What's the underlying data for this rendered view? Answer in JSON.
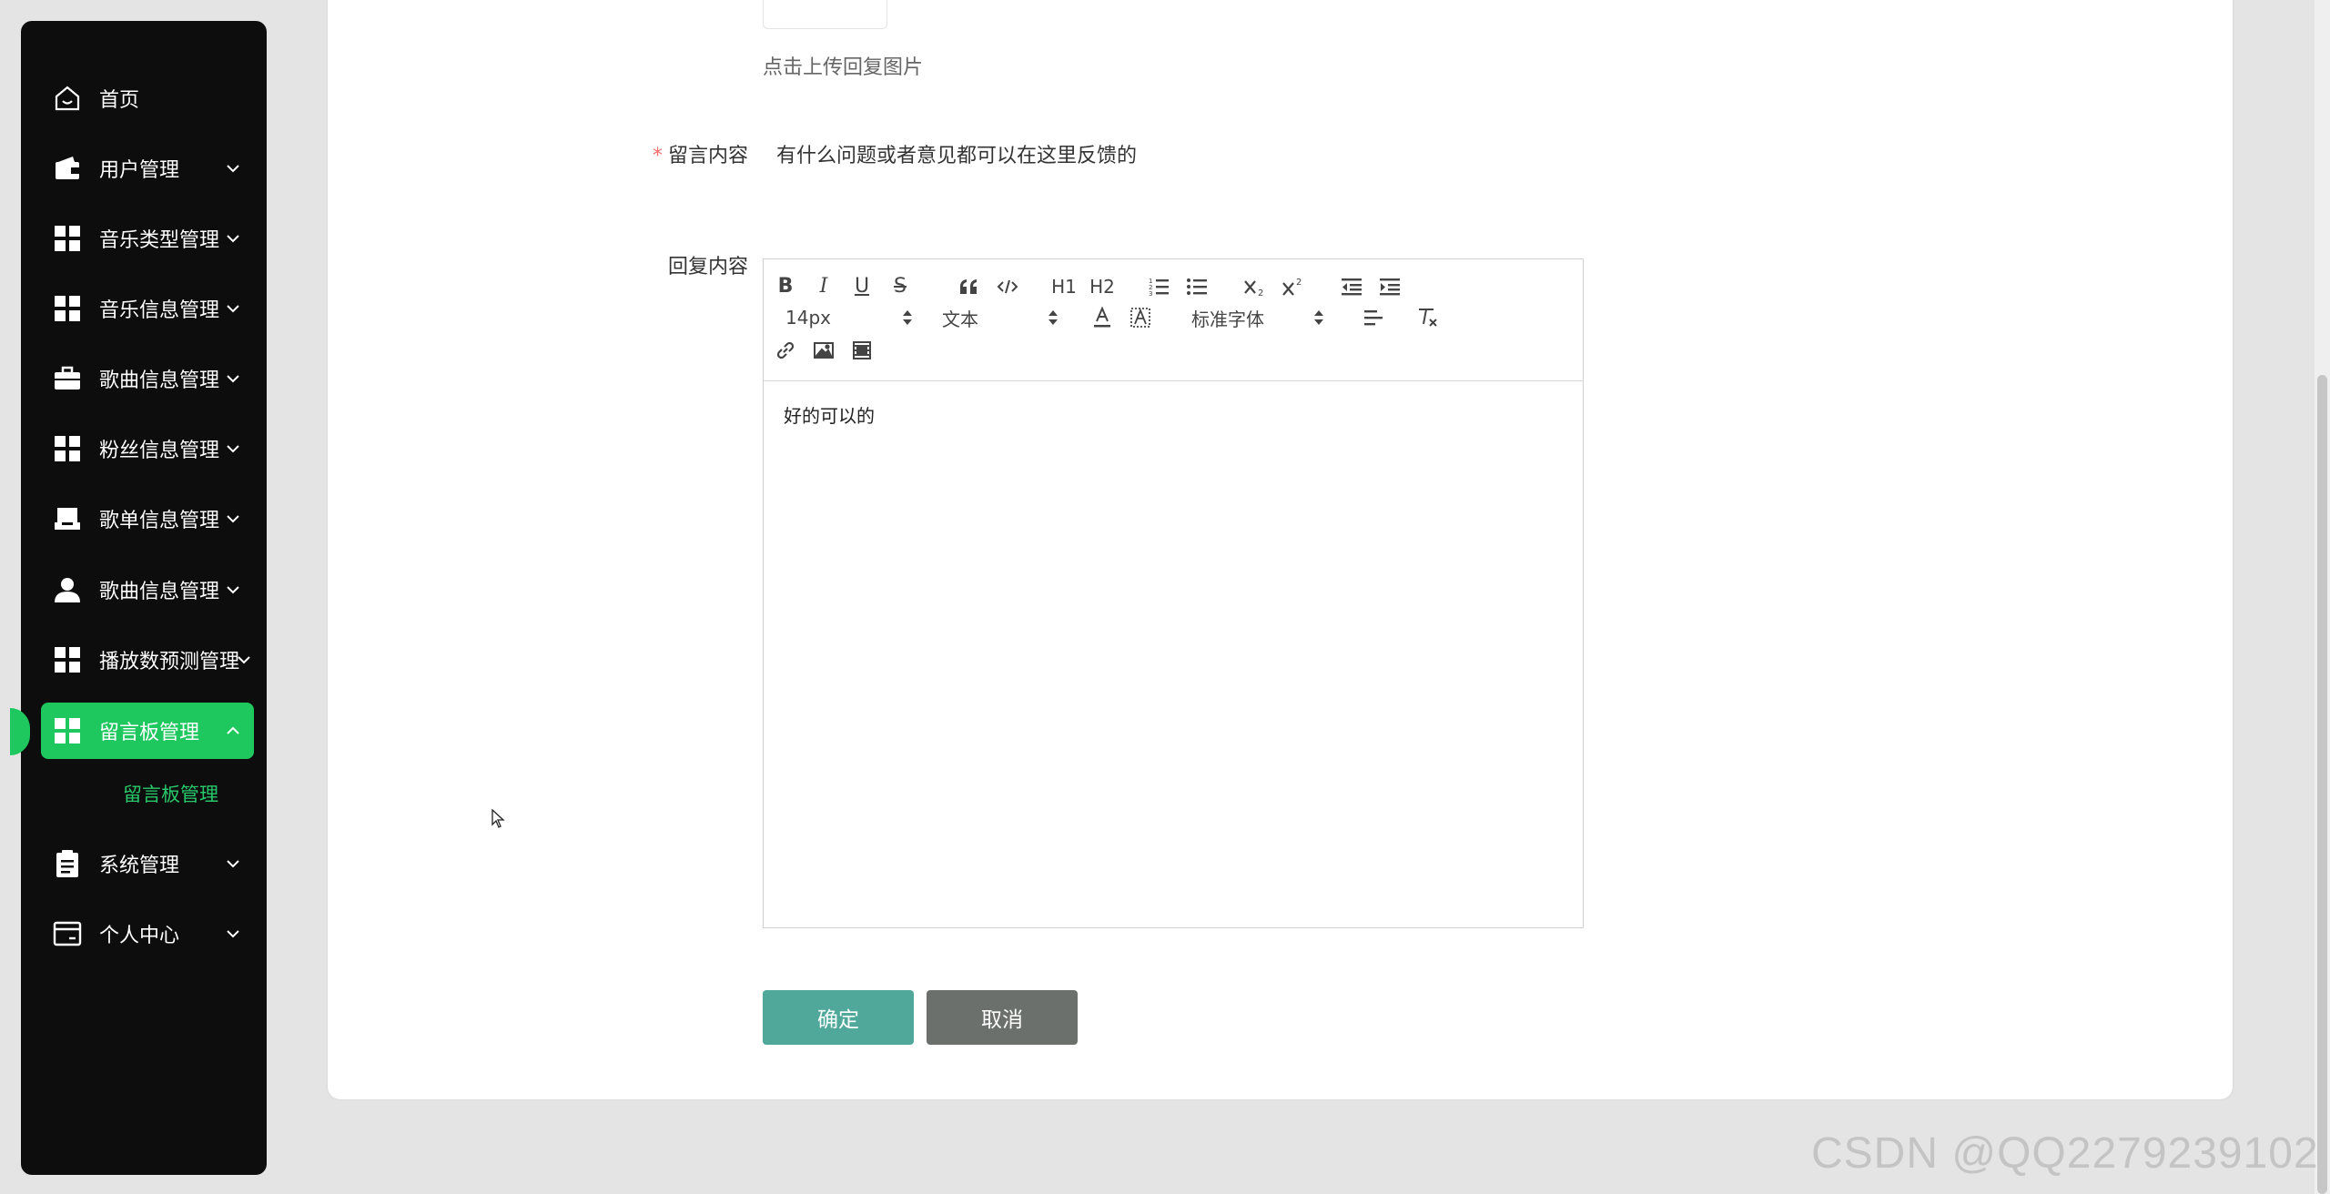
{
  "sidebar": {
    "items": [
      {
        "label": "首页",
        "icon": "home-icon"
      },
      {
        "label": "用户管理",
        "icon": "wallet-icon"
      },
      {
        "label": "音乐类型管理",
        "icon": "grid-icon"
      },
      {
        "label": "音乐信息管理",
        "icon": "grid-icon"
      },
      {
        "label": "歌曲信息管理",
        "icon": "briefcase-icon"
      },
      {
        "label": "粉丝信息管理",
        "icon": "grid-icon"
      },
      {
        "label": "歌单信息管理",
        "icon": "inbox-icon"
      },
      {
        "label": "歌曲信息管理",
        "icon": "user-icon"
      },
      {
        "label": "播放数预测管理",
        "icon": "grid-icon"
      },
      {
        "label": "留言板管理",
        "icon": "grid-icon",
        "active": true
      },
      {
        "label": "系统管理",
        "icon": "clipboard-icon"
      },
      {
        "label": "个人中心",
        "icon": "card-icon"
      }
    ],
    "sub_item": "留言板管理",
    "accent_color": "#1ec85e"
  },
  "form": {
    "upload_hint": "点击上传回复图片",
    "message_label": "留言内容",
    "message_required_mark": "*",
    "message_value": "有什么问题或者意见都可以在这里反馈的",
    "reply_label": "回复内容"
  },
  "editor": {
    "toolbar": {
      "bold": "B",
      "italic": "I",
      "underline": "U",
      "strike": "S",
      "h1": "H1",
      "h2": "H2",
      "size_value": "14px",
      "header_value": "文本",
      "font_value": "标准字体"
    },
    "content": "好的可以的"
  },
  "buttons": {
    "confirm": "确定",
    "cancel": "取消",
    "confirm_color": "#4fa89a",
    "cancel_color": "#6b706d"
  },
  "watermark": "CSDN @QQ2279239102"
}
